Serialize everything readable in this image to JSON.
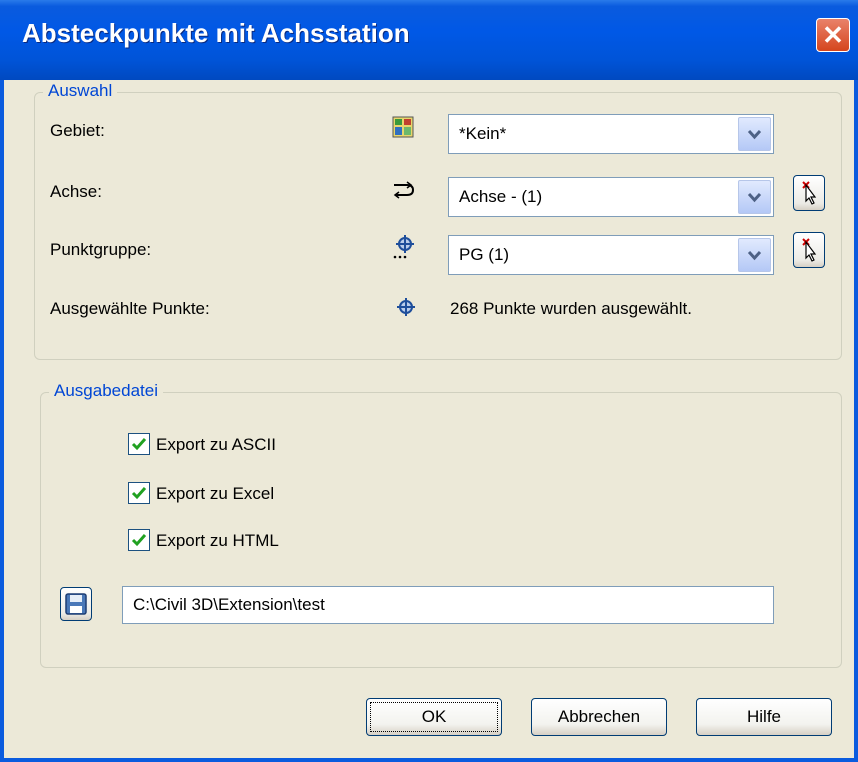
{
  "window": {
    "title": "Absteckpunkte mit Achsstation",
    "close_label": "✕"
  },
  "auswahl": {
    "legend": "Auswahl",
    "gebiet": {
      "label": "Gebiet:",
      "value": "*Kein*",
      "icon": "surface-icon"
    },
    "achse": {
      "label": "Achse:",
      "value": "Achse - (1)",
      "icon": "alignment-icon"
    },
    "punktgruppe": {
      "label": "Punktgruppe:",
      "value": "PG (1)",
      "icon": "point-group-icon"
    },
    "ausgewaehlt": {
      "label": "Ausgewählte Punkte:",
      "value": "268 Punkte wurden ausgewählt.",
      "icon": "point-icon"
    }
  },
  "ausgabe": {
    "legend": "Ausgabedatei",
    "checkboxes": [
      {
        "label": "Export zu ASCII",
        "checked": true
      },
      {
        "label": "Export zu Excel",
        "checked": true
      },
      {
        "label": "Export zu HTML",
        "checked": true
      }
    ],
    "path": "C:\\Civil 3D\\Extension\\test"
  },
  "buttons": {
    "ok": "OK",
    "cancel": "Abbrechen",
    "help": "Hilfe"
  },
  "colors": {
    "titlebar": "#0058E6",
    "accent_text": "#0046D5",
    "check": "#21A121",
    "close": "#D5451D"
  }
}
